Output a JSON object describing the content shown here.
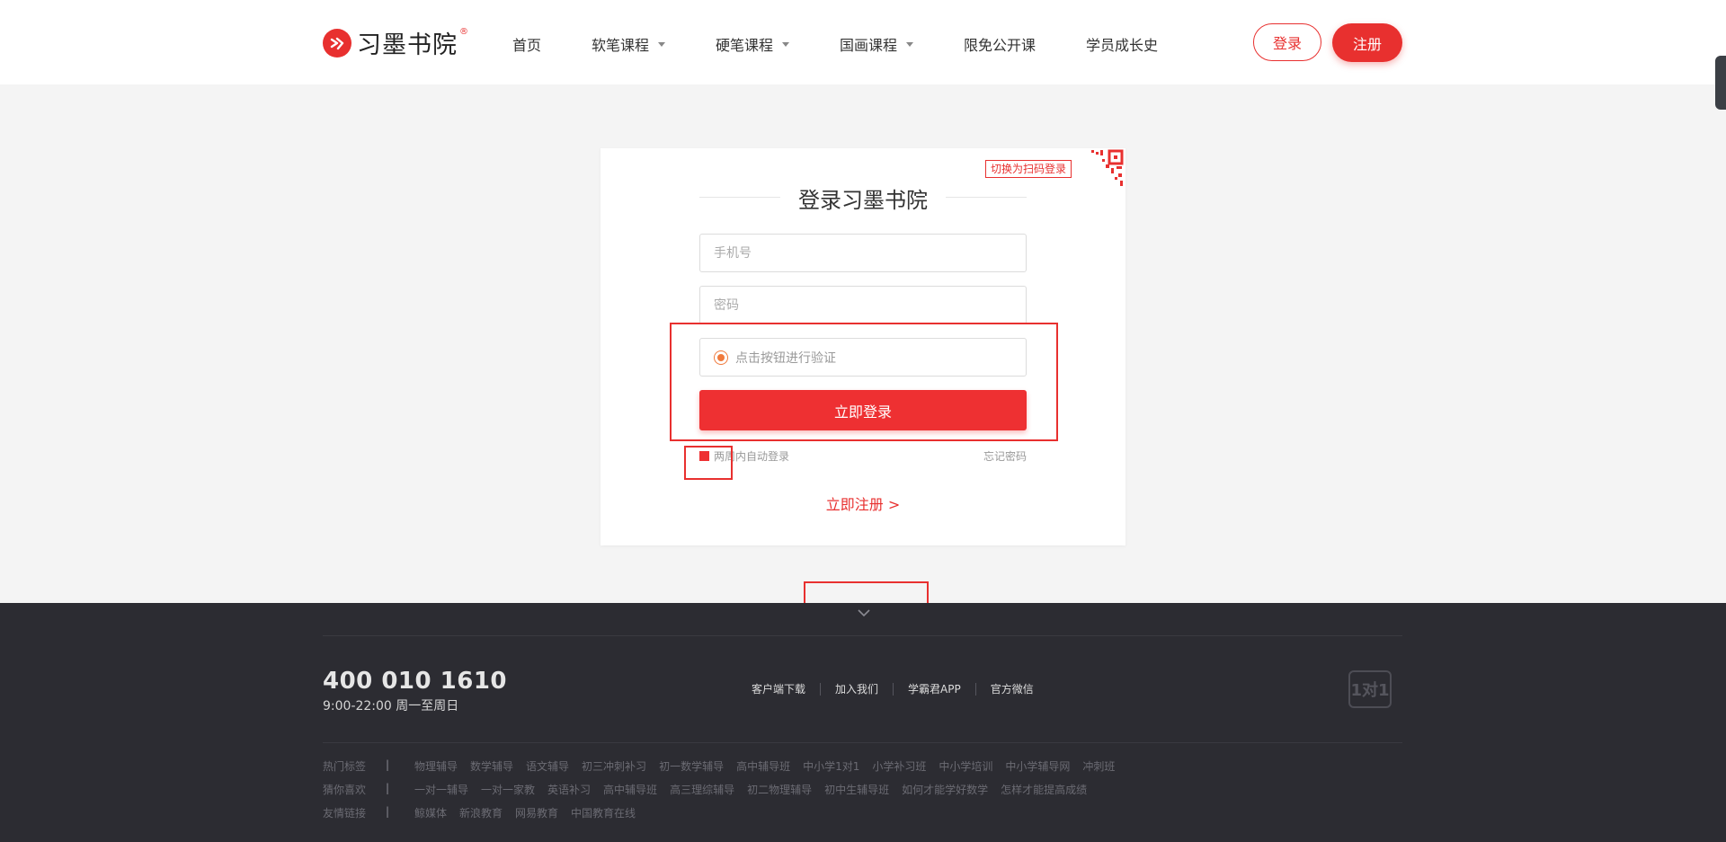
{
  "header": {
    "logo_text": "习墨书院",
    "nav": [
      {
        "label": "首页",
        "dropdown": false
      },
      {
        "label": "软笔课程",
        "dropdown": true
      },
      {
        "label": "硬笔课程",
        "dropdown": true
      },
      {
        "label": "国画课程",
        "dropdown": true
      },
      {
        "label": "限免公开课",
        "dropdown": false
      },
      {
        "label": "学员成长史",
        "dropdown": false
      }
    ],
    "login_label": "登录",
    "register_label": "注册"
  },
  "login": {
    "qr_switch": "切换为扫码登录",
    "title": "登录习墨书院",
    "phone_placeholder": "手机号",
    "password_placeholder": "密码",
    "verify_text": "点击按钮进行验证",
    "submit_label": "立即登录",
    "remember_label": "两周内自动登录",
    "forgot_label": "忘记密码",
    "register_link": "立即注册 >"
  },
  "footer": {
    "phone": "400 010 1610",
    "hours": "9:00-22:00 周一至周日",
    "links": [
      "客户端下载",
      "加入我们",
      "学霸君APP",
      "官方微信"
    ],
    "badge": "1对1",
    "tag_rows": [
      {
        "label": "热门标签",
        "sep": "|",
        "tags": [
          "物理辅导",
          "数学辅导",
          "语文辅导",
          "初三冲刺补习",
          "初一数学辅导",
          "高中辅导班",
          "中小学1对1",
          "小学补习班",
          "中小学培训",
          "中小学辅导网",
          "冲刺班"
        ]
      },
      {
        "label": "猜你喜欢",
        "sep": "|",
        "tags": [
          "一对一辅导",
          "一对一家教",
          "英语补习",
          "高中辅导班",
          "高三理综辅导",
          "初二物理辅导",
          "初中生辅导班",
          "如何才能学好数学",
          "怎样才能提高成绩"
        ]
      },
      {
        "label": "友情链接",
        "sep": "|",
        "tags": [
          "鲸媒体",
          "新浪教育",
          "网易教育",
          "中国教育在线"
        ]
      }
    ]
  },
  "colors": {
    "accent": "#e8302f",
    "footer_bg": "#2c2c32",
    "page_bg": "#f4f4f4"
  }
}
